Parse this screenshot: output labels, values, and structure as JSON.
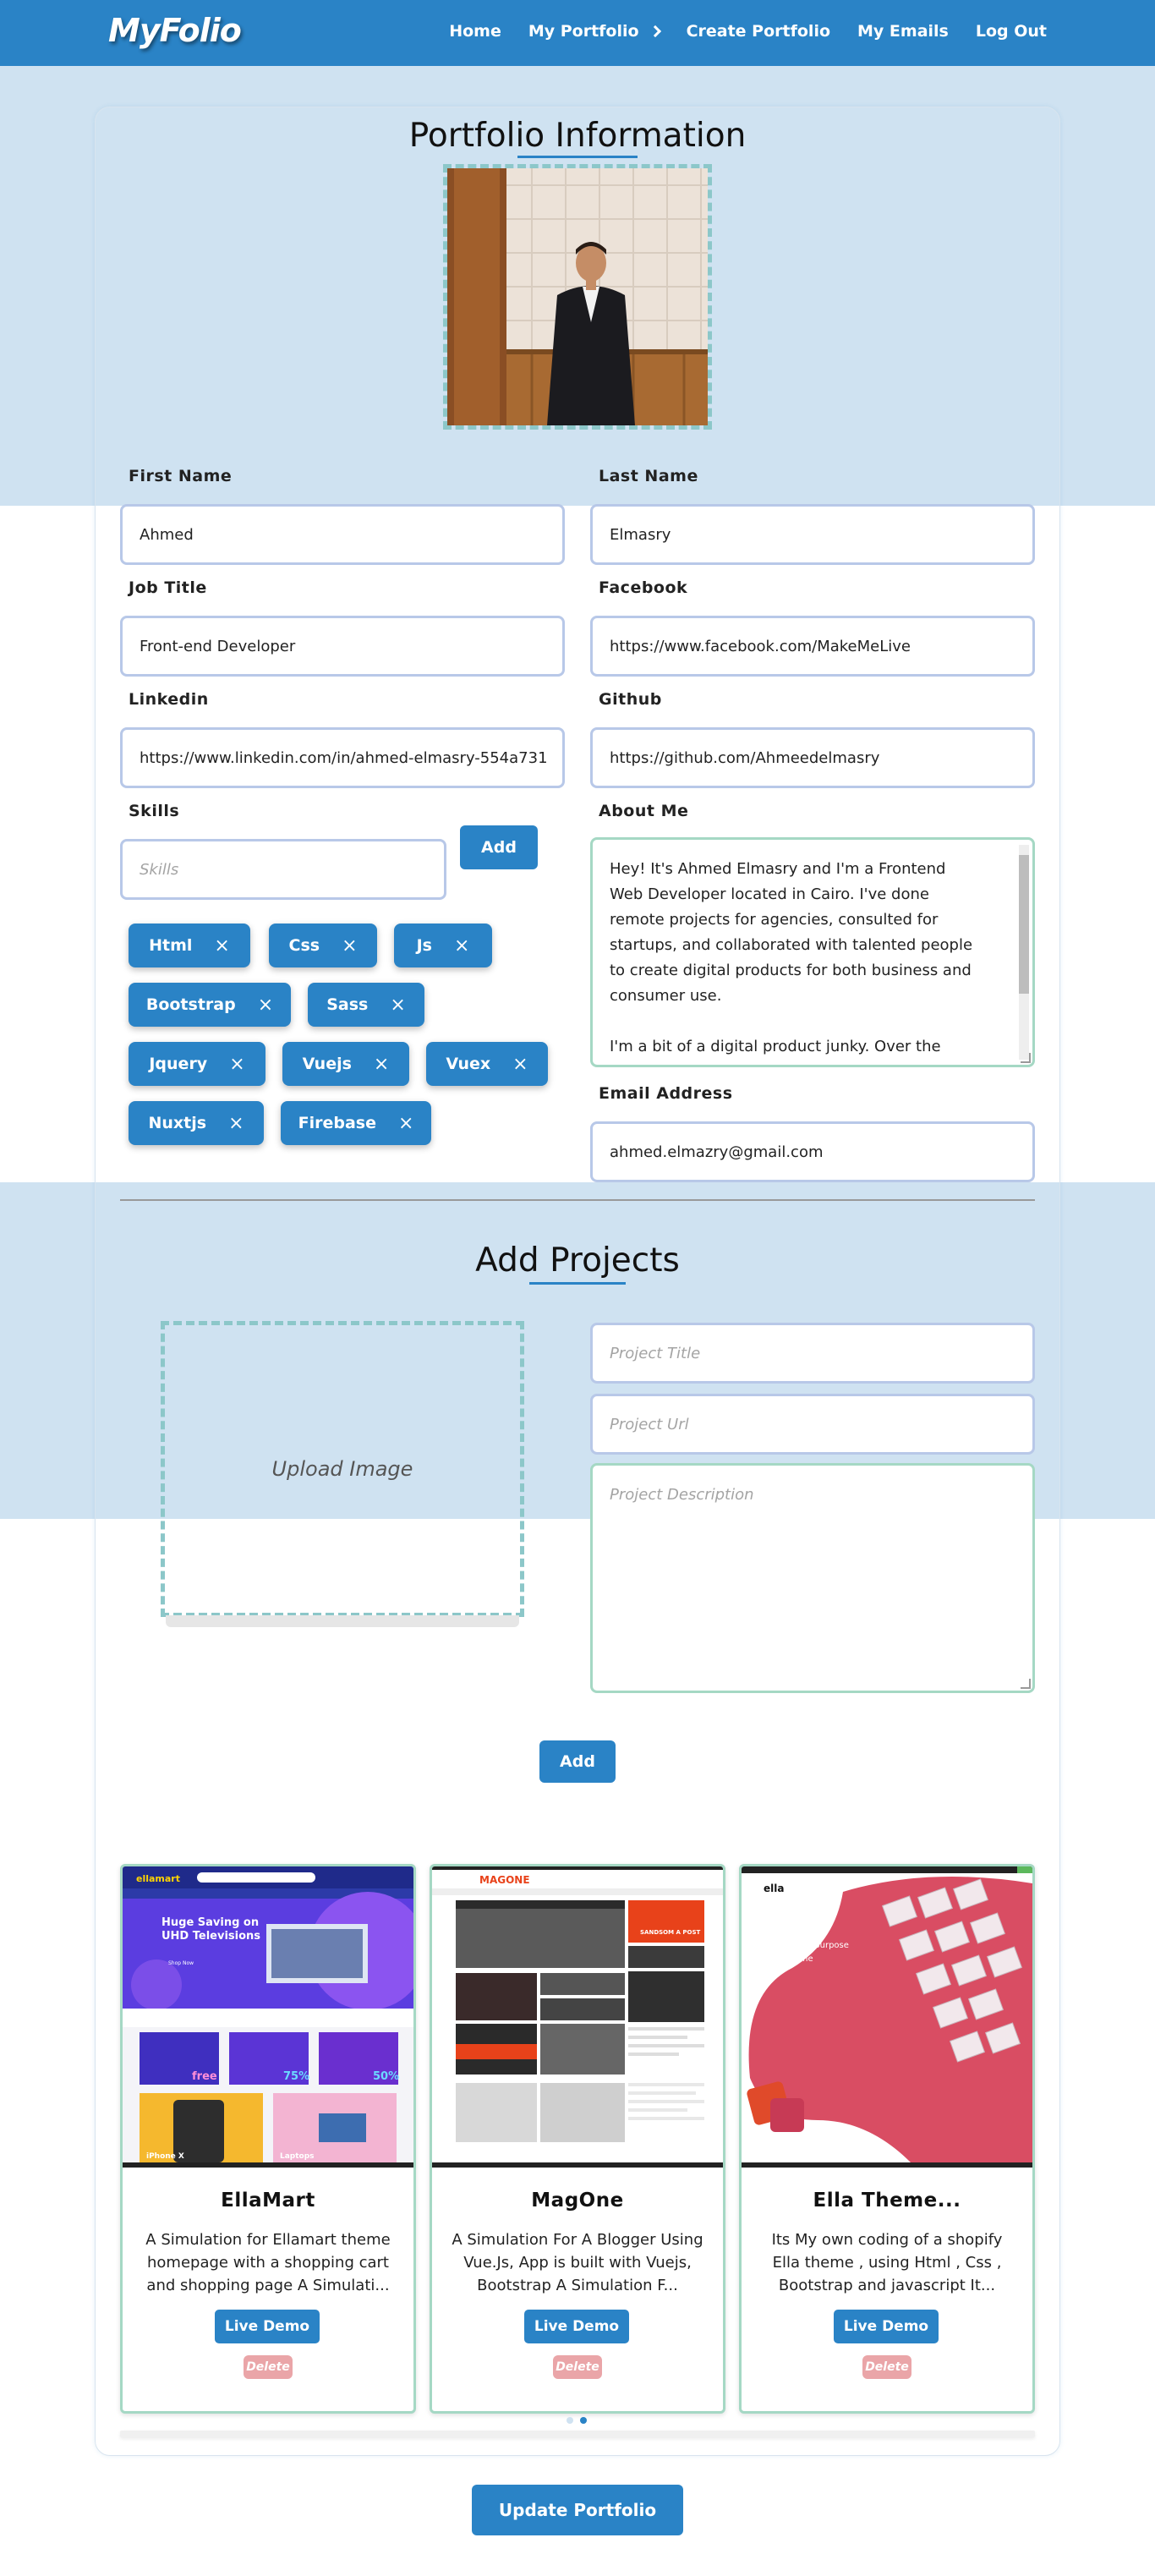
{
  "nav": {
    "logo": "MyFolio",
    "links": [
      {
        "label": "Home"
      },
      {
        "label": "My Portfolio"
      },
      {
        "label": "Create Portfolio"
      },
      {
        "label": "My Emails"
      },
      {
        "label": "Log Out"
      }
    ]
  },
  "portfolio": {
    "title": "Portfolio Information",
    "fields": {
      "first_name": {
        "label": "First Name",
        "value": "Ahmed"
      },
      "last_name": {
        "label": "Last Name",
        "value": "Elmasry"
      },
      "job_title": {
        "label": "Job Title",
        "value": "Front-end Developer"
      },
      "facebook": {
        "label": "Facebook",
        "value": "https://www.facebook.com/MakeMeLive"
      },
      "linkedin": {
        "label": "Linkedin",
        "value": "https://www.linkedin.com/in/ahmed-elmasry-554a731"
      },
      "github": {
        "label": "Github",
        "value": "https://github.com/Ahmeedelmasry"
      },
      "skills": {
        "label": "Skills",
        "placeholder": "Skills",
        "add_label": "Add"
      },
      "about": {
        "label": "About Me",
        "paragraph1": "Hey! It's Ahmed Elmasry and I'm a Frontend Web Developer located in Cairo. I've done remote projects for agencies, consulted for startups, and collaborated with talented people to create digital products for both business and consumer use.",
        "paragraph2": "I'm a bit of a digital product junky. Over the"
      },
      "email": {
        "label": "Email Address",
        "value": "ahmed.elmazry@gmail.com"
      }
    },
    "skills": [
      "Html",
      "Css",
      "Js",
      "Bootstrap",
      "Sass",
      "Jquery",
      "Vuejs",
      "Vuex",
      "Nuxtjs",
      "Firebase"
    ],
    "remove_icon": "×"
  },
  "add_projects": {
    "title": "Add Projects",
    "upload_label": "Upload Image",
    "title_placeholder": "Project Title",
    "url_placeholder": "Project Url",
    "description_placeholder": "Project Description",
    "add_label": "Add"
  },
  "projects": [
    {
      "title": "EllaMart",
      "description": "A Simulation for Ellamart theme homepage with a shopping cart and shopping page A Simulati...",
      "demo_label": "Live Demo",
      "delete_label": "Delete"
    },
    {
      "title": "MagOne",
      "description": "A Simulation For A Blogger Using Vue.Js, App is built with Vuejs, Bootstrap A Simulation F...",
      "demo_label": "Live Demo",
      "delete_label": "Delete"
    },
    {
      "title": "Ella Theme...",
      "description": "Its My own coding of a shopify Ella theme , using Html , Css , Bootstrap and javascript It...",
      "demo_label": "Live Demo",
      "delete_label": "Delete"
    }
  ],
  "thumbnails": {
    "ellamart": {
      "brand": "ellamart",
      "hero1": "Huge Saving on",
      "hero2": "UHD Televisions",
      "hero_btn": "Shop Now",
      "tile1": "free",
      "tile2": "75%",
      "tile3": "50%",
      "promo1": "iPhone X",
      "promo2": "Laptops"
    },
    "magone": {
      "brand": "MAGONE",
      "tag": "SANDSOM A POST"
    },
    "ella": {
      "brand": "ella",
      "headline1": "Creative multi-purpose",
      "headline2": "Shopify theme"
    }
  },
  "update_label": "Update Portfolio",
  "colors": {
    "primary": "#2a83c6",
    "band": "#cfe2f1",
    "dashed": "#8cc7c9",
    "delete": "#eaa5a8"
  }
}
